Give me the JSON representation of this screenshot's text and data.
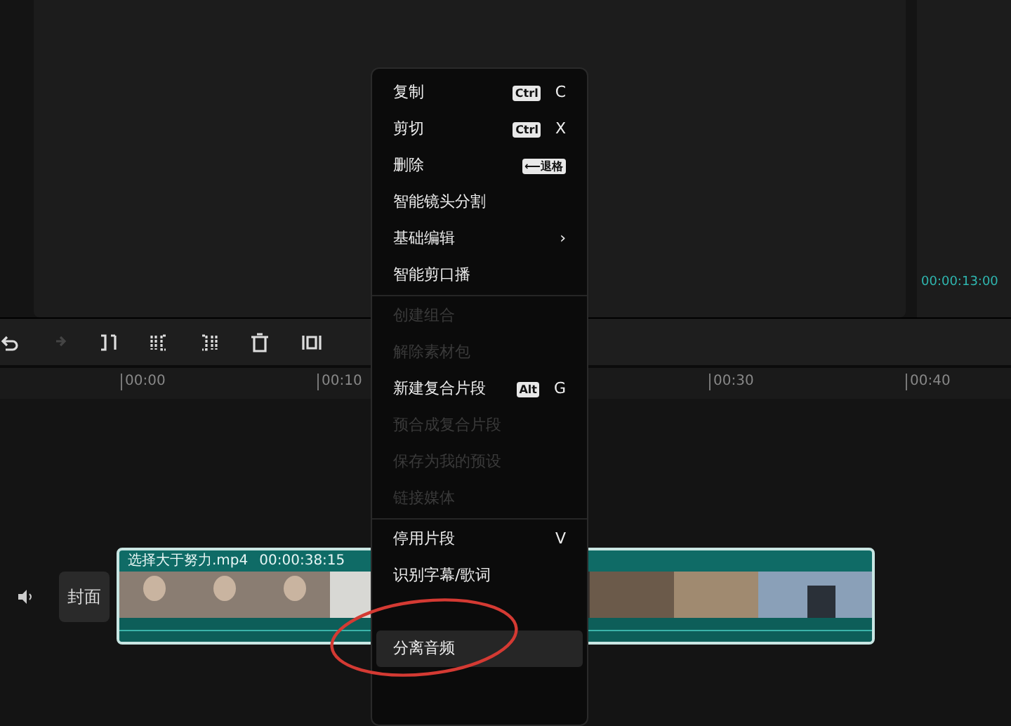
{
  "preview": {
    "timecode": "00:00:13:00"
  },
  "ruler": {
    "labels": [
      "00:00",
      "00:10",
      "00:30",
      "00:40"
    ]
  },
  "track": {
    "cover_label": "封面",
    "clip_name": "选择大于努力.mp4",
    "clip_duration": "00:00:38:15"
  },
  "context_menu": {
    "items": [
      {
        "kind": "item",
        "label": "复制",
        "disabled": false,
        "selected": false,
        "modifier": "Ctrl",
        "key": "C"
      },
      {
        "kind": "item",
        "label": "剪切",
        "disabled": false,
        "selected": false,
        "modifier": "Ctrl",
        "key": "X"
      },
      {
        "kind": "item",
        "label": "删除",
        "disabled": false,
        "selected": false,
        "modifier": "⟵退格"
      },
      {
        "kind": "item",
        "label": "智能镜头分割",
        "disabled": false,
        "selected": false
      },
      {
        "kind": "submenu",
        "label": "基础编辑",
        "disabled": false,
        "selected": false,
        "arrow": "›"
      },
      {
        "kind": "item",
        "label": "智能剪口播",
        "disabled": false,
        "selected": false
      },
      {
        "kind": "separator"
      },
      {
        "kind": "item",
        "label": "创建组合",
        "disabled": true,
        "selected": false
      },
      {
        "kind": "item",
        "label": "解除素材包",
        "disabled": true,
        "selected": false
      },
      {
        "kind": "item",
        "label": "新建复合片段",
        "disabled": false,
        "selected": false,
        "modifier": "Alt",
        "key": "G"
      },
      {
        "kind": "item",
        "label": "预合成复合片段",
        "disabled": true,
        "selected": false
      },
      {
        "kind": "item",
        "label": "保存为我的预设",
        "disabled": true,
        "selected": false
      },
      {
        "kind": "item",
        "label": "链接媒体",
        "disabled": true,
        "selected": false
      },
      {
        "kind": "separator"
      },
      {
        "kind": "item",
        "label": "停用片段",
        "disabled": false,
        "selected": false,
        "key": "V"
      },
      {
        "kind": "item",
        "label": "识别字幕/歌词",
        "disabled": false,
        "selected": false
      },
      {
        "kind": "gap"
      },
      {
        "kind": "item",
        "label": "分离音频",
        "disabled": false,
        "selected": true
      }
    ]
  }
}
